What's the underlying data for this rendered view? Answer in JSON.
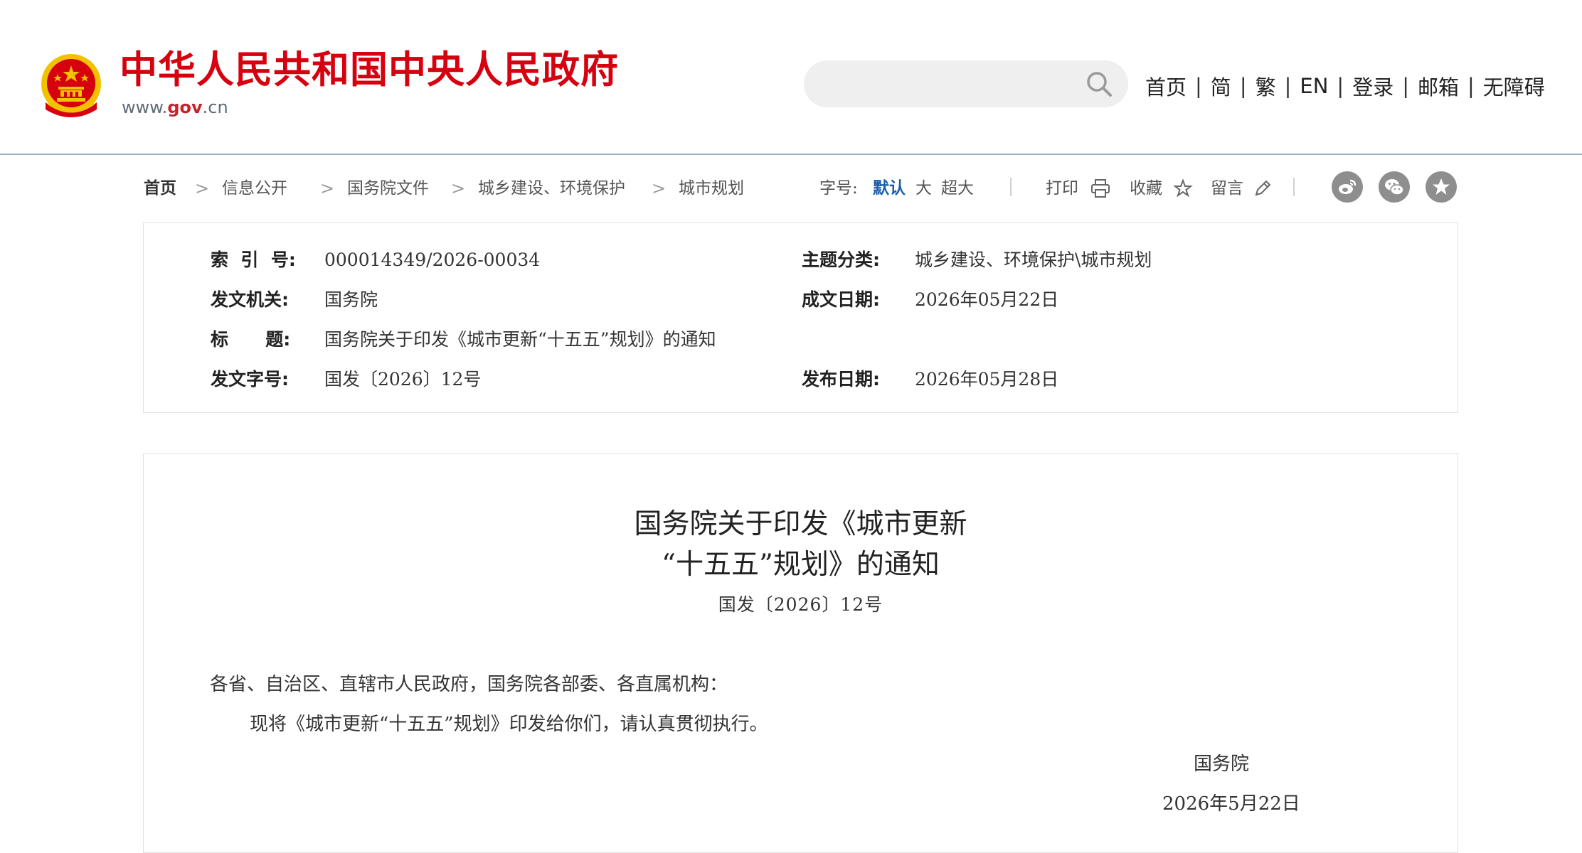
{
  "header": {
    "site_title": "中华人民共和国中央人民政府",
    "site_url_prefix": "www.",
    "site_url_domain": "gov",
    "site_url_suffix": ".cn",
    "search_placeholder": "",
    "links": [
      "首页",
      "简",
      "繁",
      "EN",
      "登录",
      "邮箱",
      "无障碍"
    ],
    "separator": "|"
  },
  "breadcrumb": [
    "首页",
    "信息公开",
    "国务院文件",
    "城乡建设、环境保护",
    "城市规划"
  ],
  "breadcrumb_sep": ">",
  "toolbar": {
    "fontsize_label": "字号:",
    "fontsize_default": "默认",
    "fontsize_large": "大",
    "fontsize_xlarge": "超大",
    "print": "打印",
    "favorite": "收藏",
    "comment": "留言",
    "share_icons": [
      "weibo-icon",
      "wechat-icon",
      "favorites-star-icon"
    ]
  },
  "meta": {
    "index_label": "索  引  号:",
    "index_value": "000014349/2026-00034",
    "topic_label": "主题分类:",
    "topic_value": "城乡建设、环境保护\\城市规划",
    "issuer_label": "发文机关:",
    "issuer_value": "国务院",
    "date_written_label": "成文日期:",
    "date_written_value": "2026年05月22日",
    "title_label": "标      题:",
    "title_value": "国务院关于印发《城市更新“十五五”规划》的通知",
    "docno_label": "发文字号:",
    "docno_value": "国发〔2026〕12号",
    "date_published_label": "发布日期:",
    "date_published_value": "2026年05月28日"
  },
  "article": {
    "title_line1": "国务院关于印发《城市更新",
    "title_line2": "“十五五”规划》的通知",
    "doc_number": "国发〔2026〕12号",
    "salutation": "各省、自治区、直辖市人民政府，国务院各部委、各直属机构：",
    "body": "现将《城市更新“十五五”规划》印发给你们，请认真贯彻执行。",
    "signature": "国务院",
    "date": "2026年5月22日"
  },
  "colors": {
    "brand_red": "#d6000f",
    "active_blue": "#1d5ea8",
    "header_rule": "#9ab0c2",
    "emblem_gold": "#f2c200"
  }
}
